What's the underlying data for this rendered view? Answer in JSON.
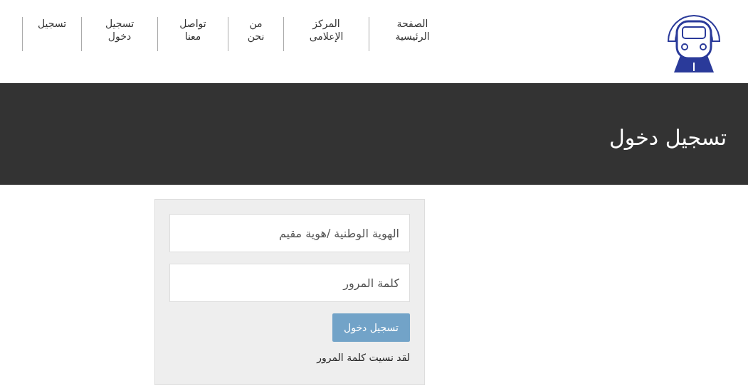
{
  "nav": {
    "items": [
      {
        "label": "الصفحة الرئيسية"
      },
      {
        "label": "المركز الإعلامى"
      },
      {
        "label": "من نحن"
      },
      {
        "label": "تواصل معنا"
      },
      {
        "label": "تسجيل دخول"
      },
      {
        "label": "تسجيل"
      }
    ]
  },
  "banner": {
    "title": "تسجيل دخول"
  },
  "login_form": {
    "id_field": {
      "placeholder": "الهوية الوطنية /هوية مقيم"
    },
    "password_field": {
      "placeholder": "كلمة المرور"
    },
    "submit_button": "تسجيل دخول",
    "forgot_link": "لقد نسيت كلمة المرور"
  }
}
